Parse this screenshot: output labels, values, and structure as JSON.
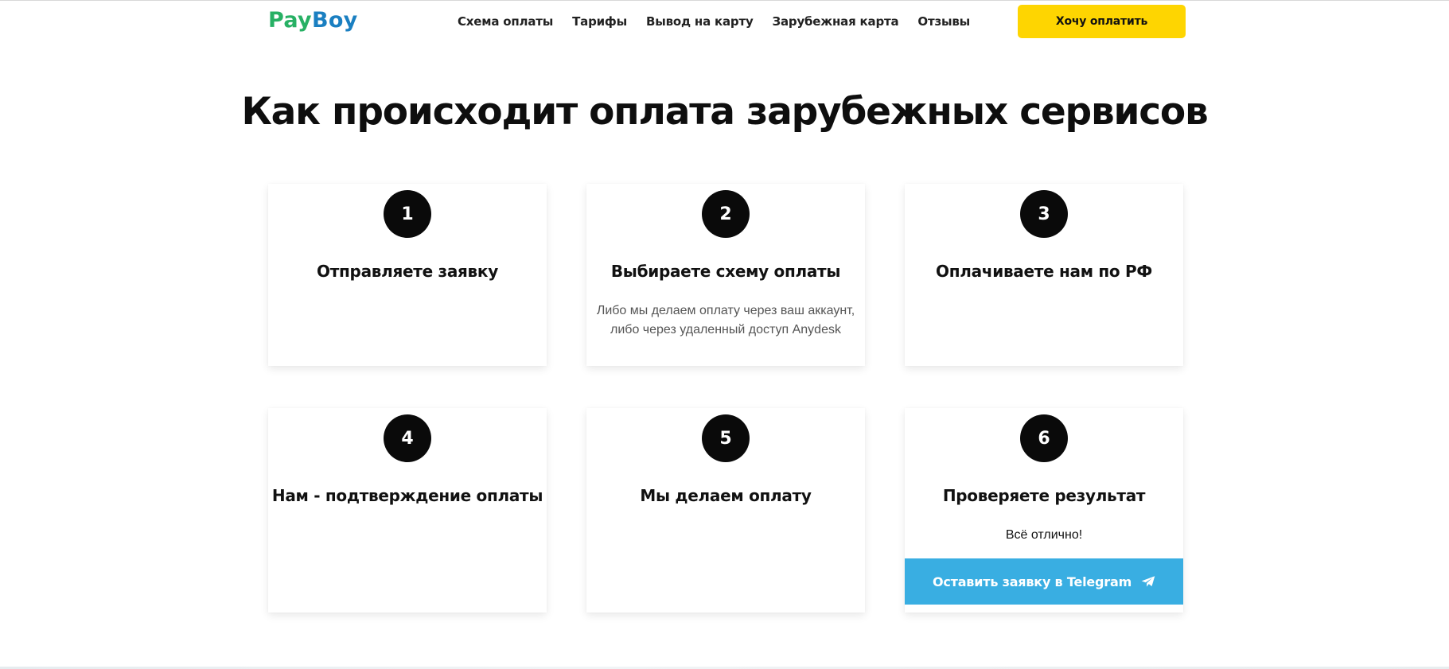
{
  "header": {
    "logo": {
      "part1": "Pay",
      "part2": "Boy"
    },
    "nav": [
      {
        "label": "Схема оплаты"
      },
      {
        "label": "Тарифы"
      },
      {
        "label": "Вывод на карту"
      },
      {
        "label": "Зарубежная карта"
      },
      {
        "label": "Отзывы"
      }
    ],
    "cta_label": "Хочу оплатить"
  },
  "main": {
    "title": "Как происходит оплата зарубежных сервисов",
    "steps": [
      {
        "number": "1",
        "title": "Отправляете заявку",
        "desc": ""
      },
      {
        "number": "2",
        "title": "Выбираете схему оплаты",
        "desc_line1": "Либо мы делаем оплату через ваш аккаунт,",
        "desc_line2": "либо через удаленный доступ Anydesk"
      },
      {
        "number": "3",
        "title": "Оплачиваете нам по РФ",
        "desc": ""
      },
      {
        "number": "4",
        "title": "Нам - подтверждение оплаты",
        "desc": ""
      },
      {
        "number": "5",
        "title": "Мы делаем оплату",
        "desc": ""
      },
      {
        "number": "6",
        "title": "Проверяете результат",
        "desc": "Всё отлично!",
        "button_label": "Оставить заявку в Telegram"
      }
    ]
  },
  "colors": {
    "logo_green": "#27b064",
    "logo_blue": "#1a7fc1",
    "cta_yellow": "#fed501",
    "telegram_blue": "#39aee2",
    "step_circle": "#0a0a0a"
  },
  "icons": {
    "telegram": "paper-plane-icon"
  }
}
